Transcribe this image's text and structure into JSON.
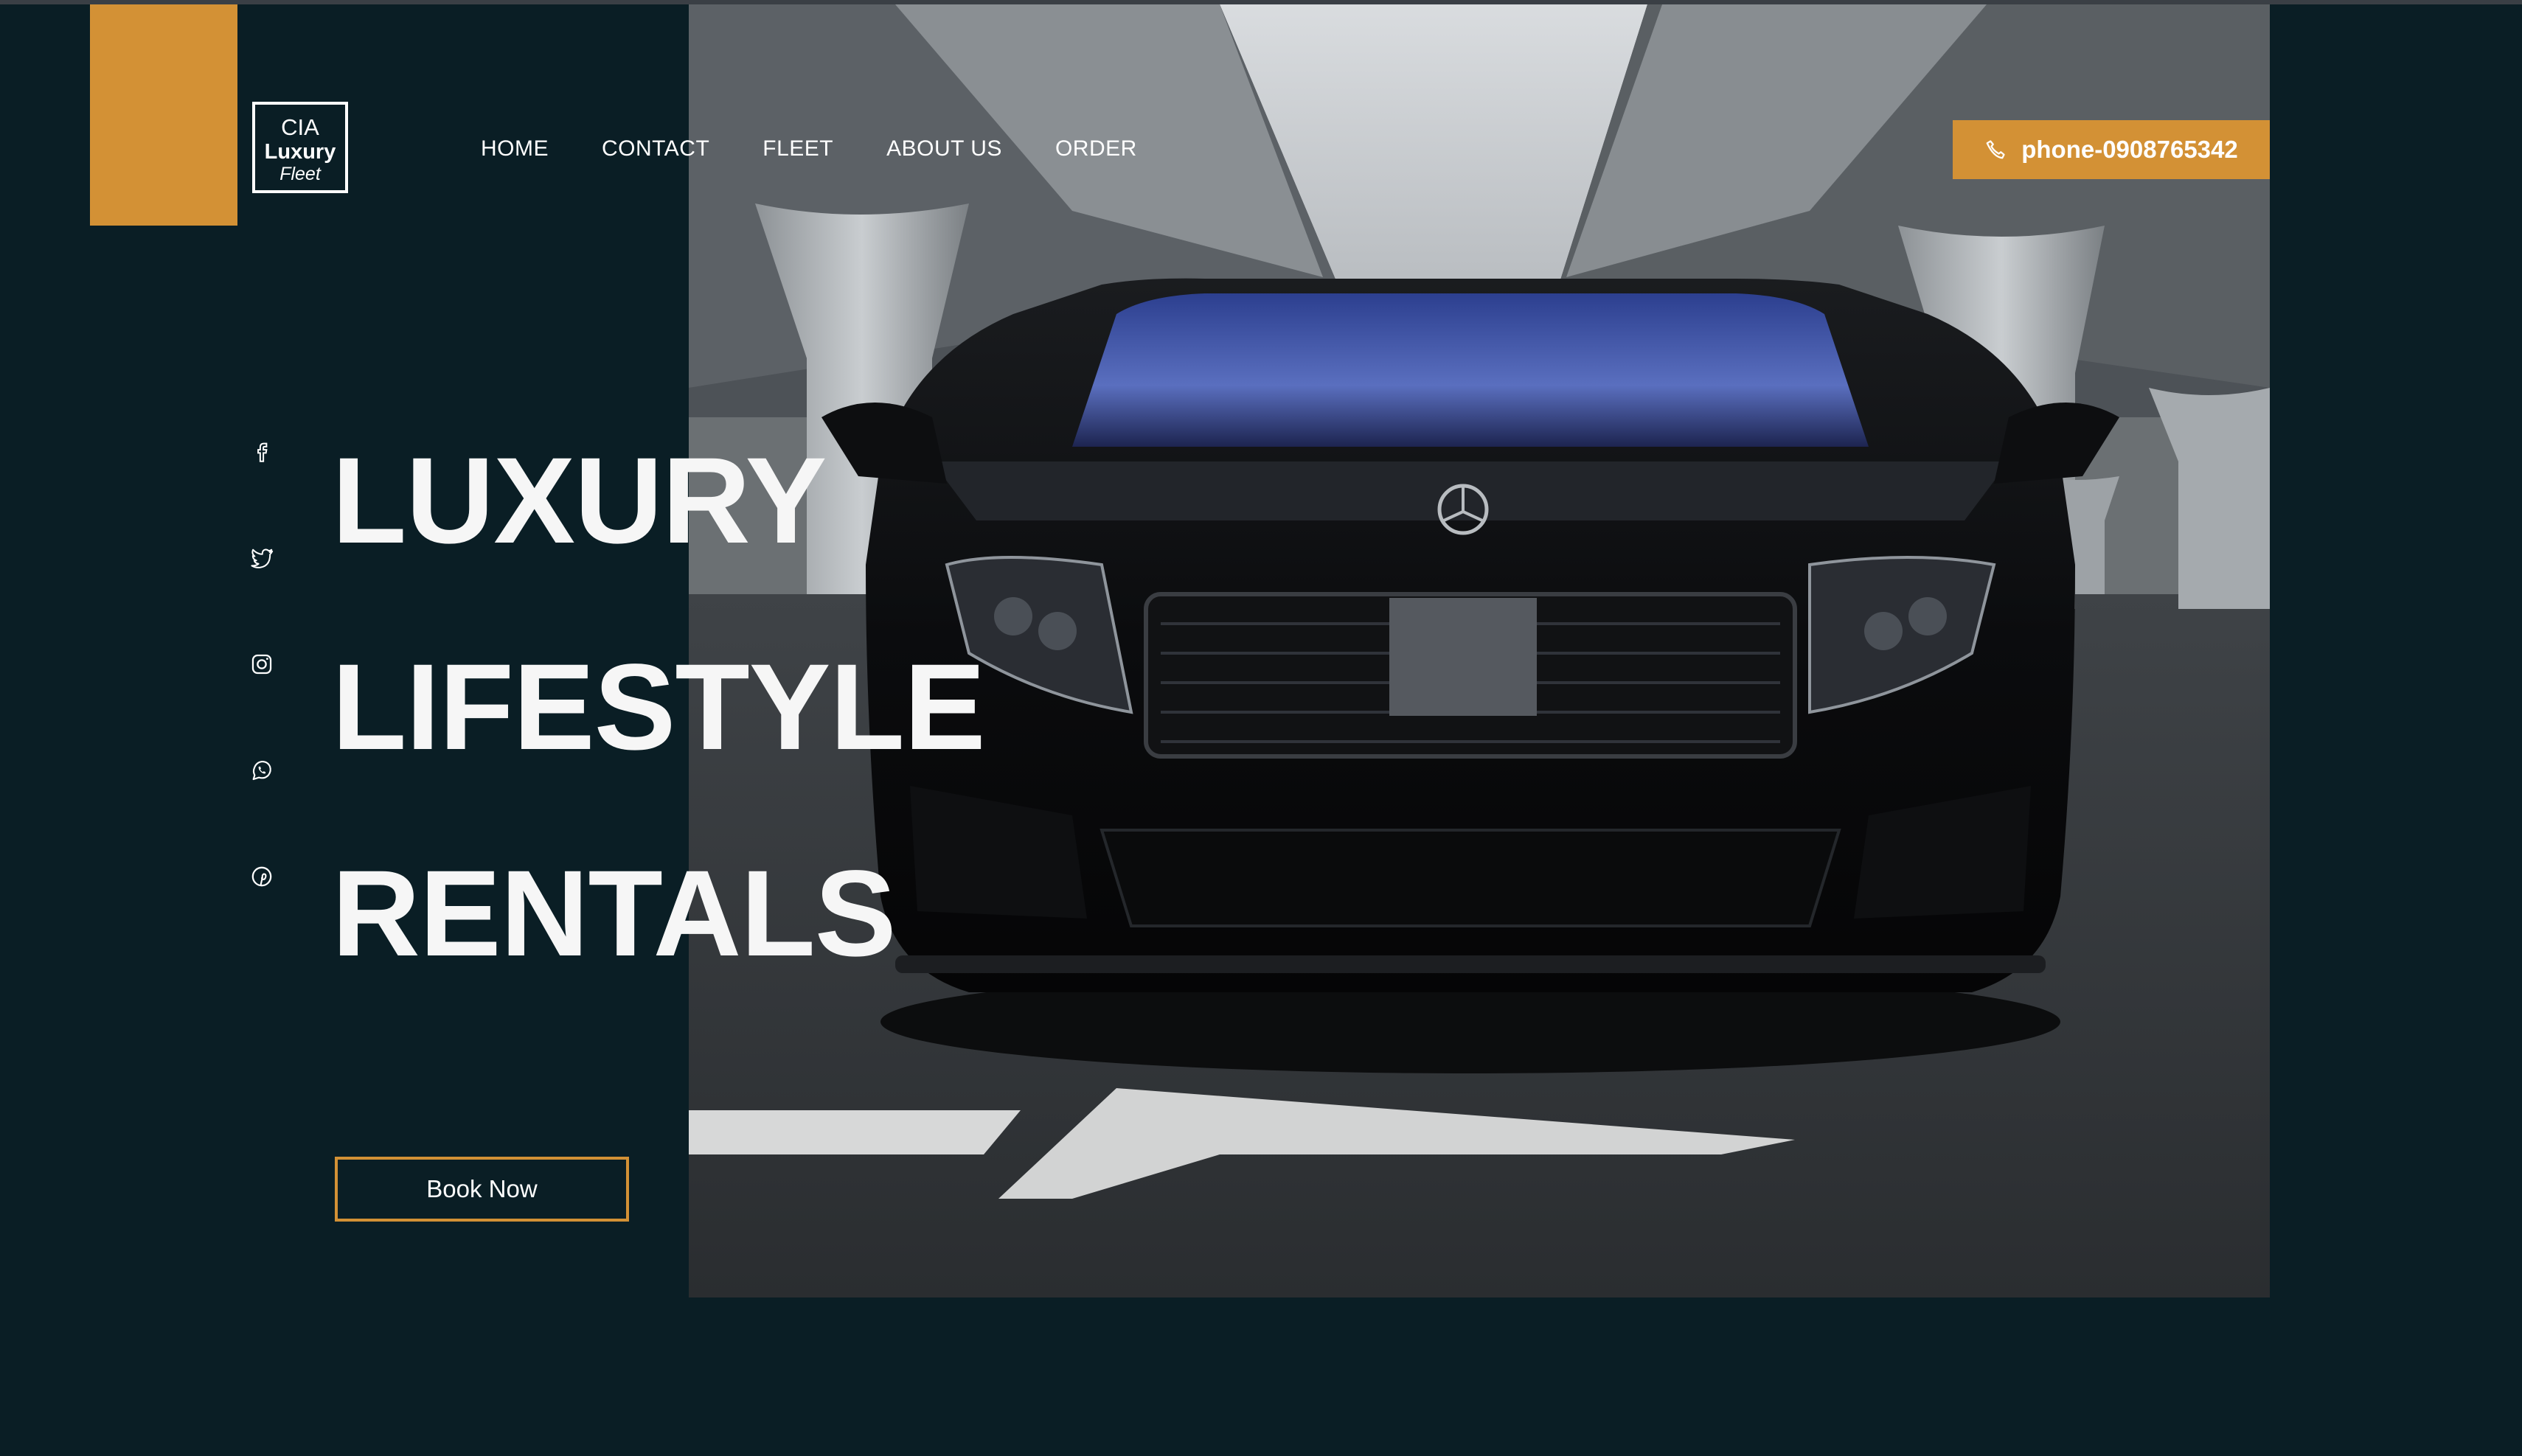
{
  "brand": {
    "line1": "CIA",
    "line2": "Luxury",
    "line3": "Fleet",
    "accent_color": "#d39135",
    "background_color": "#0a1e25"
  },
  "nav": {
    "items": [
      {
        "label": "HOME"
      },
      {
        "label": "CONTACT"
      },
      {
        "label": "FLEET"
      },
      {
        "label": "ABOUT US"
      },
      {
        "label": "ORDER"
      }
    ]
  },
  "phone_button": {
    "label": "phone-0908765342",
    "icon": "phone-icon"
  },
  "social": [
    {
      "icon": "facebook-icon"
    },
    {
      "icon": "twitter-icon"
    },
    {
      "icon": "instagram-icon"
    },
    {
      "icon": "whatsapp-icon"
    },
    {
      "icon": "pinterest-icon"
    }
  ],
  "hero": {
    "headline_lines": [
      "LUXURY",
      "LIFESTYLE",
      "RENTALS"
    ],
    "book_button": "Book Now",
    "image": "black luxury sedan under highway overpass"
  }
}
